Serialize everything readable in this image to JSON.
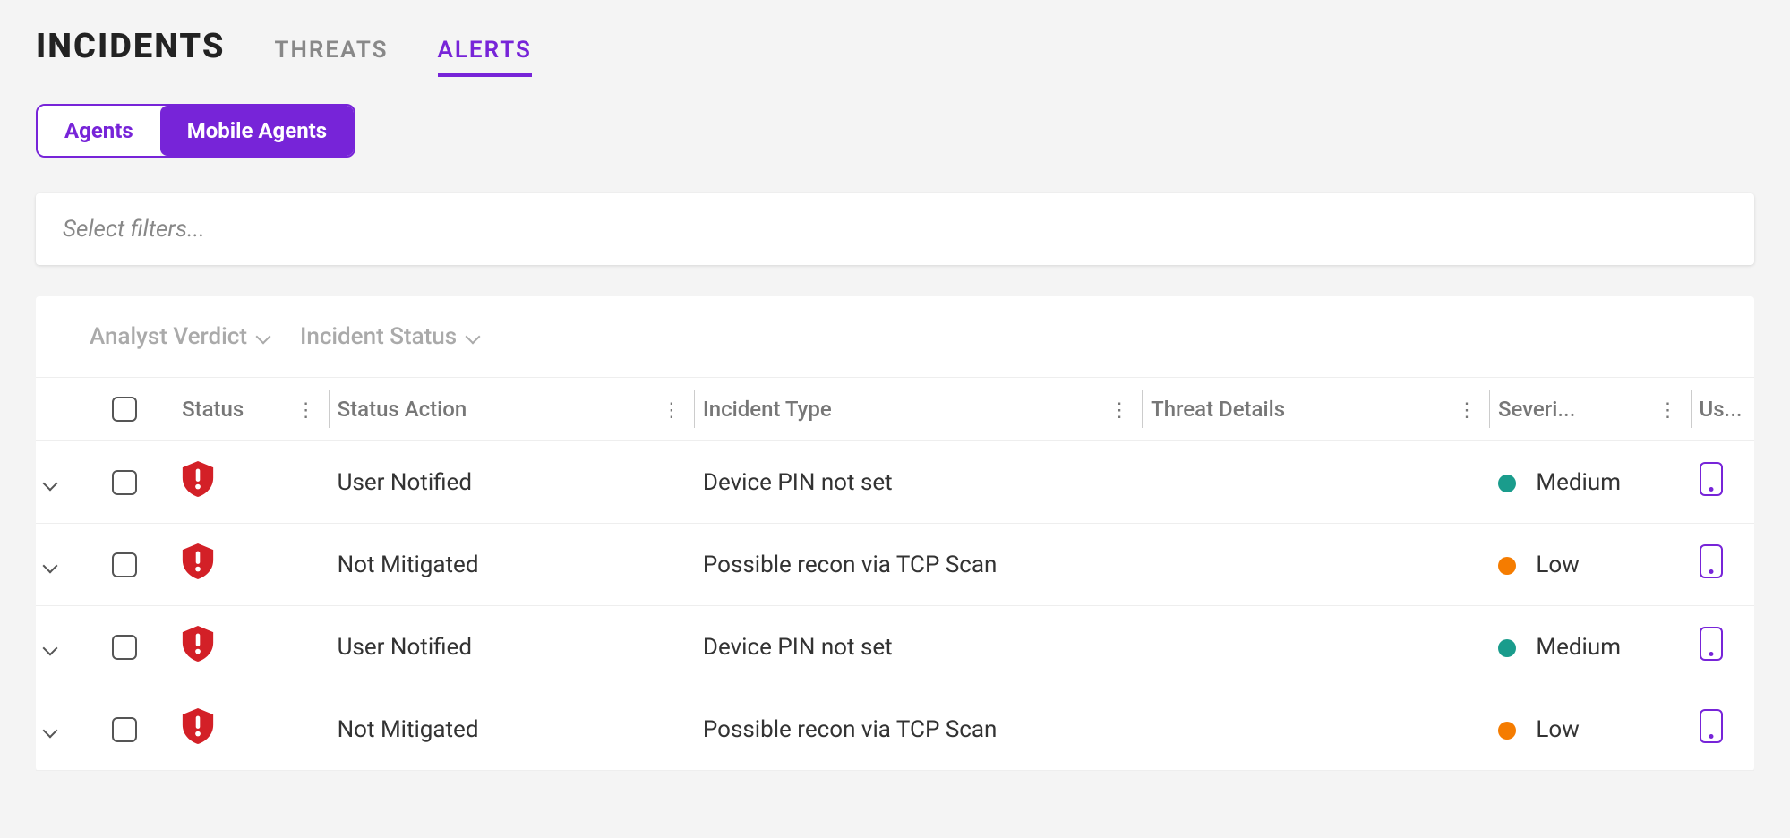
{
  "tabs": {
    "page_title": "INCIDENTS",
    "threats": "THREATS",
    "alerts": "ALERTS",
    "active": "alerts"
  },
  "segmented": {
    "agents": "Agents",
    "mobile_agents": "Mobile Agents",
    "active": "mobile_agents"
  },
  "filter_placeholder": "Select filters...",
  "bulk": {
    "analyst_verdict": "Analyst Verdict",
    "incident_status": "Incident Status"
  },
  "columns": {
    "status": "Status",
    "status_action": "Status Action",
    "incident_type": "Incident Type",
    "threat_details": "Threat Details",
    "severity": "Severi...",
    "user": "Us..."
  },
  "severity_colors": {
    "Medium": "teal",
    "Low": "orange"
  },
  "rows": [
    {
      "status_action": "User Notified",
      "incident_type": "Device PIN not set",
      "threat_details": "",
      "severity": "Medium"
    },
    {
      "status_action": "Not Mitigated",
      "incident_type": "Possible recon via TCP Scan",
      "threat_details": "",
      "severity": "Low"
    },
    {
      "status_action": "User Notified",
      "incident_type": "Device PIN not set",
      "threat_details": "",
      "severity": "Medium"
    },
    {
      "status_action": "Not Mitigated",
      "incident_type": "Possible recon via TCP Scan",
      "threat_details": "",
      "severity": "Low"
    }
  ]
}
